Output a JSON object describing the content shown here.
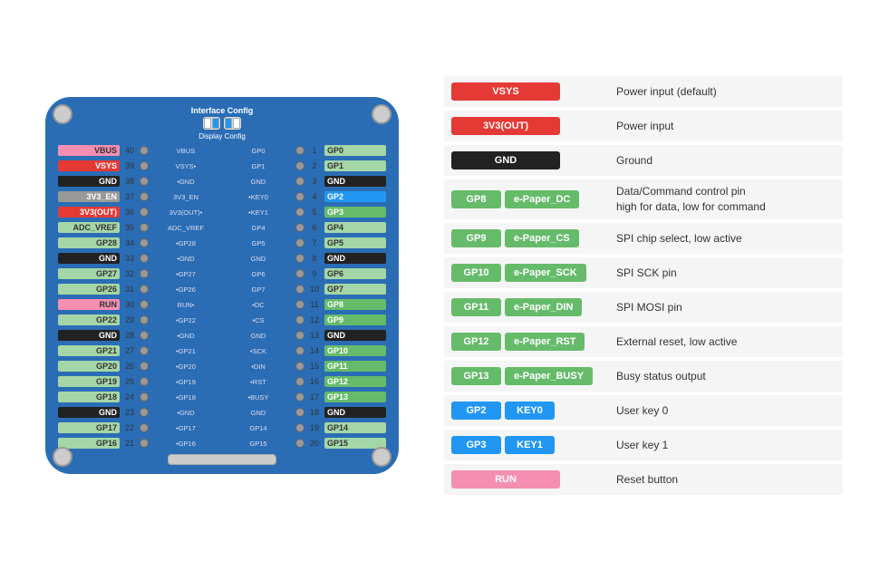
{
  "board": {
    "title": "Interface Config",
    "subtitle": "Display Config",
    "pins": [
      {
        "left_label": "VBUS",
        "left_color": "c-pink",
        "left_num": "40",
        "center_l": "VBUS",
        "center_r": "GP0",
        "right_num": "1",
        "right_label": "GP0",
        "right_color": "c-lightgreen"
      },
      {
        "left_label": "VSYS",
        "left_color": "c-red",
        "left_num": "39",
        "center_l": "VSYS•",
        "center_r": "GP1",
        "right_num": "2",
        "right_label": "GP1",
        "right_color": "c-lightgreen"
      },
      {
        "left_label": "GND",
        "left_color": "c-black",
        "left_num": "38",
        "center_l": "•GND",
        "center_r": "GND",
        "right_num": "3",
        "right_label": "GND",
        "right_color": "c-black"
      },
      {
        "left_label": "3V3_EN",
        "left_color": "c-gray",
        "left_num": "37",
        "center_l": "3V3_EN",
        "center_r": "•KEY0",
        "right_num": "4",
        "right_label": "GP2",
        "right_color": "c-blue"
      },
      {
        "left_label": "3V3(OUT)",
        "left_color": "c-red",
        "left_num": "36",
        "center_l": "3V3(OUT)•",
        "center_r": "•KEY1",
        "right_num": "5",
        "right_label": "GP3",
        "right_color": "c-green"
      },
      {
        "left_label": "ADC_VREF",
        "left_color": "c-lightgreen",
        "left_num": "35",
        "center_l": "ADC_VREF",
        "center_r": "GP4",
        "right_num": "6",
        "right_label": "GP4",
        "right_color": "c-lightgreen"
      },
      {
        "left_label": "GP28",
        "left_color": "c-lightgreen",
        "left_num": "34",
        "center_l": "•GP28",
        "center_r": "GP5",
        "right_num": "7",
        "right_label": "GP5",
        "right_color": "c-lightgreen"
      },
      {
        "left_label": "GND",
        "left_color": "c-black",
        "left_num": "33",
        "center_l": "•GND",
        "center_r": "GND",
        "right_num": "8",
        "right_label": "GND",
        "right_color": "c-black"
      },
      {
        "left_label": "GP27",
        "left_color": "c-lightgreen",
        "left_num": "32",
        "center_l": "•GP27",
        "center_r": "GP6",
        "right_num": "9",
        "right_label": "GP6",
        "right_color": "c-lightgreen"
      },
      {
        "left_label": "GP26",
        "left_color": "c-lightgreen",
        "left_num": "31",
        "center_l": "•GP26",
        "center_r": "GP7",
        "right_num": "10",
        "right_label": "GP7",
        "right_color": "c-lightgreen"
      },
      {
        "left_label": "RUN",
        "left_color": "c-pink",
        "left_num": "30",
        "center_l": "RUN•",
        "center_r": "•DC",
        "right_num": "11",
        "right_label": "GP8",
        "right_color": "c-green"
      },
      {
        "left_label": "GP22",
        "left_color": "c-lightgreen",
        "left_num": "29",
        "center_l": "•GP22",
        "center_r": "•CS",
        "right_num": "12",
        "right_label": "GP9",
        "right_color": "c-green"
      },
      {
        "left_label": "GND",
        "left_color": "c-black",
        "left_num": "28",
        "center_l": "•GND",
        "center_r": "GND",
        "right_num": "13",
        "right_label": "GND",
        "right_color": "c-black"
      },
      {
        "left_label": "GP21",
        "left_color": "c-lightgreen",
        "left_num": "27",
        "center_l": "•GP21",
        "center_r": "•SCK",
        "right_num": "14",
        "right_label": "GP10",
        "right_color": "c-green"
      },
      {
        "left_label": "GP20",
        "left_color": "c-lightgreen",
        "left_num": "26",
        "center_l": "•GP20",
        "center_r": "•DIN",
        "right_num": "15",
        "right_label": "GP11",
        "right_color": "c-green"
      },
      {
        "left_label": "GP19",
        "left_color": "c-lightgreen",
        "left_num": "25",
        "center_l": "•GP19",
        "center_r": "•RST",
        "right_num": "16",
        "right_label": "GP12",
        "right_color": "c-green"
      },
      {
        "left_label": "GP18",
        "left_color": "c-lightgreen",
        "left_num": "24",
        "center_l": "•GP18",
        "center_r": "•BUSY",
        "right_num": "17",
        "right_label": "GP13",
        "right_color": "c-green"
      },
      {
        "left_label": "GND",
        "left_color": "c-black",
        "left_num": "23",
        "center_l": "•GND",
        "center_r": "GND",
        "right_num": "18",
        "right_label": "GND",
        "right_color": "c-black"
      },
      {
        "left_label": "GP17",
        "left_color": "c-lightgreen",
        "left_num": "22",
        "center_l": "•GP17",
        "center_r": "GP14",
        "right_num": "19",
        "right_label": "GP14",
        "right_color": "c-lightgreen"
      },
      {
        "left_label": "GP16",
        "left_color": "c-lightgreen",
        "left_num": "21",
        "center_l": "•GP16",
        "center_r": "GP15",
        "right_num": "20",
        "right_label": "GP15",
        "right_color": "c-lightgreen"
      }
    ]
  },
  "legend": {
    "items": [
      {
        "badges": [
          {
            "label": "VSYS",
            "color": "l-red",
            "wide": true
          }
        ],
        "desc": "Power input (default)"
      },
      {
        "badges": [
          {
            "label": "3V3(OUT)",
            "color": "l-red",
            "wide": true
          }
        ],
        "desc": "Power input"
      },
      {
        "badges": [
          {
            "label": "GND",
            "color": "l-black",
            "wide": true
          }
        ],
        "desc": "Ground"
      },
      {
        "badges": [
          {
            "label": "GP8",
            "color": "l-green",
            "wide": false
          },
          {
            "label": "e-Paper_DC",
            "color": "l-green",
            "wide": false
          }
        ],
        "desc": "Data/Command control pin\nhigh for data, low for command",
        "tall": true
      },
      {
        "badges": [
          {
            "label": "GP9",
            "color": "l-green",
            "wide": false
          },
          {
            "label": "e-Paper_CS",
            "color": "l-green",
            "wide": false
          }
        ],
        "desc": "SPI chip select, low active"
      },
      {
        "badges": [
          {
            "label": "GP10",
            "color": "l-green",
            "wide": false
          },
          {
            "label": "e-Paper_SCK",
            "color": "l-green",
            "wide": false
          }
        ],
        "desc": "SPI SCK pin"
      },
      {
        "badges": [
          {
            "label": "GP11",
            "color": "l-green",
            "wide": false
          },
          {
            "label": "e-Paper_DIN",
            "color": "l-green",
            "wide": false
          }
        ],
        "desc": "SPI MOSI pin"
      },
      {
        "badges": [
          {
            "label": "GP12",
            "color": "l-green",
            "wide": false
          },
          {
            "label": "e-Paper_RST",
            "color": "l-green",
            "wide": false
          }
        ],
        "desc": "External reset, low active"
      },
      {
        "badges": [
          {
            "label": "GP13",
            "color": "l-green",
            "wide": false
          },
          {
            "label": "e-Paper_BUSY",
            "color": "l-green",
            "wide": false
          }
        ],
        "desc": "Busy status output"
      },
      {
        "badges": [
          {
            "label": "GP2",
            "color": "l-blue",
            "wide": false
          },
          {
            "label": "KEY0",
            "color": "l-blue",
            "wide": false
          }
        ],
        "desc": "User key 0"
      },
      {
        "badges": [
          {
            "label": "GP3",
            "color": "l-blue",
            "wide": false
          },
          {
            "label": "KEY1",
            "color": "l-blue",
            "wide": false
          }
        ],
        "desc": "User key 1"
      },
      {
        "badges": [
          {
            "label": "RUN",
            "color": "l-pink",
            "wide": true
          }
        ],
        "desc": "Reset button"
      }
    ]
  }
}
